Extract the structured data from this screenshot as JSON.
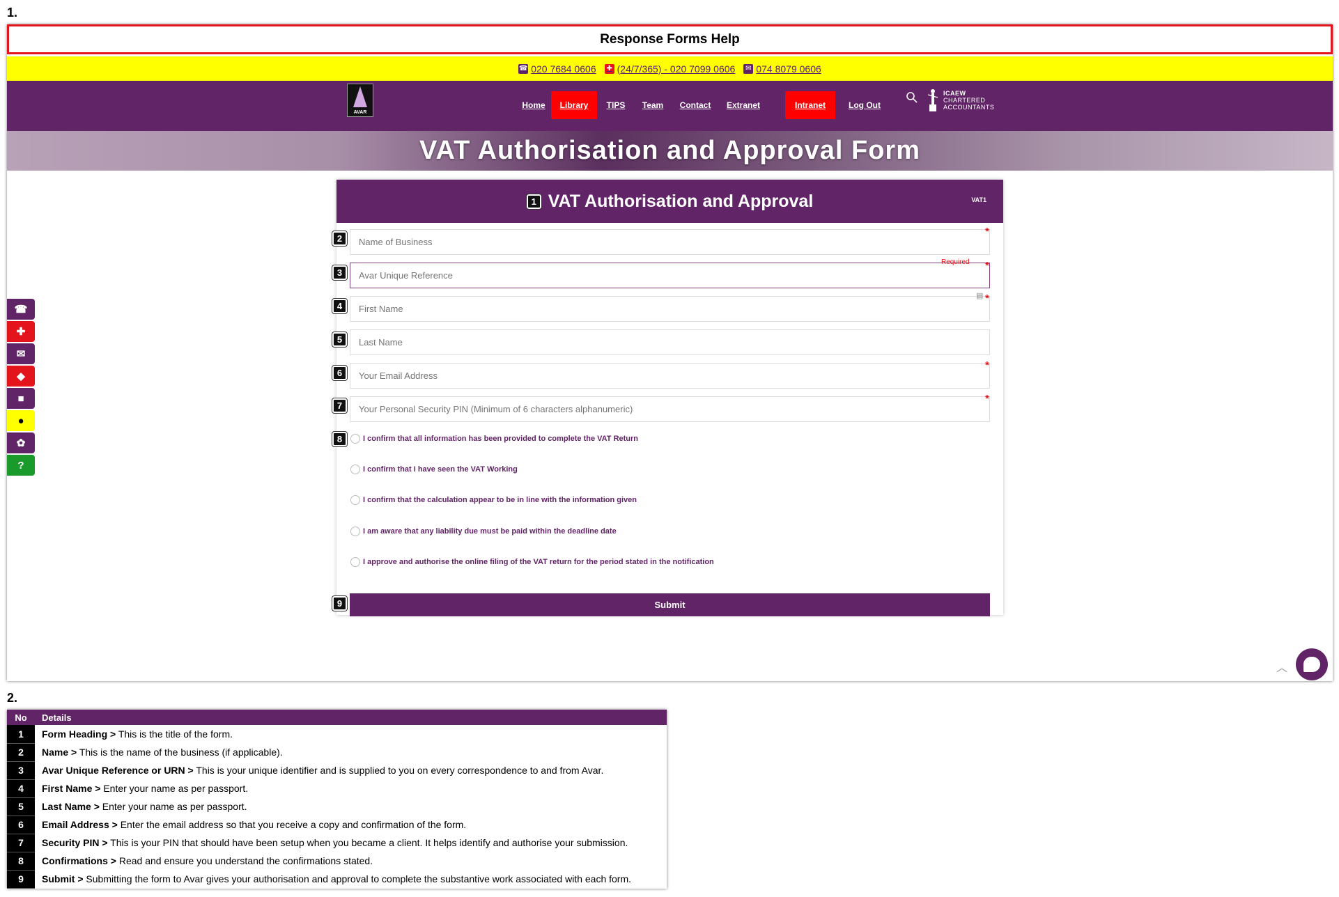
{
  "sections": {
    "first": "1.",
    "second": "2."
  },
  "help_title": "Response Forms Help",
  "phones": [
    {
      "icon": "phone-icon",
      "label": "020 7684 0606",
      "color": "#612466"
    },
    {
      "icon": "ambulance-icon",
      "label": "(24/7/365) - 020 7099 0606",
      "color": "#e3141b"
    },
    {
      "icon": "chat-icon",
      "label": "074 8079 0606",
      "color": "#612466"
    }
  ],
  "logo": {
    "text": "AVAR"
  },
  "nav": [
    {
      "label": "Home",
      "highlight": false
    },
    {
      "label": "Library",
      "highlight": true
    },
    {
      "label": "TIPS",
      "highlight": false
    },
    {
      "label": "Team",
      "highlight": false
    },
    {
      "label": "Contact",
      "highlight": false
    },
    {
      "label": "Extranet",
      "highlight": false
    },
    {
      "label": "Intranet",
      "highlight": true
    },
    {
      "label": "Log Out",
      "highlight": false
    }
  ],
  "icaew": {
    "line1": "ICAEW",
    "line2": "CHARTERED",
    "line3": "ACCOUNTANTS"
  },
  "banner_title": "VAT Authorisation and Approval Form",
  "side_icons": [
    {
      "name": "phone-icon",
      "glyph": "☎",
      "color": "#612466"
    },
    {
      "name": "ambulance-icon",
      "glyph": "🚑",
      "color": "#e3141b"
    },
    {
      "name": "chat-icon",
      "glyph": "💬",
      "color": "#612466"
    },
    {
      "name": "eraser-icon",
      "glyph": "◼",
      "color": "#e3141b"
    },
    {
      "name": "briefcase-icon",
      "glyph": "💼",
      "color": "#612466"
    },
    {
      "name": "lightbulb-icon",
      "glyph": "💡",
      "color": "#ffff00"
    },
    {
      "name": "cookie-icon",
      "glyph": "🍪",
      "color": "#612466"
    },
    {
      "name": "help-icon",
      "glyph": "?",
      "color": "#1a9a2a"
    }
  ],
  "form": {
    "title": "VAT Authorisation and Approval",
    "code": "VAT1",
    "fields": [
      {
        "placeholder": "Name of Business",
        "required": true
      },
      {
        "placeholder": "Avar Unique Reference",
        "required": true,
        "required_text": "Required"
      },
      {
        "placeholder": "First Name",
        "required": true
      },
      {
        "placeholder": "Last Name",
        "required": false
      },
      {
        "placeholder": "Your Email Address",
        "required": true
      },
      {
        "placeholder": "Your Personal Security PIN (Minimum of 6 characters alphanumeric)",
        "required": true
      }
    ],
    "confirmations": [
      "I confirm that all information has been provided to complete the VAT Return",
      "I confirm that I have seen the VAT Working",
      "I confirm that the calculation appear to be in line with the information given",
      "I am aware that any liability due must be paid within the deadline date",
      "I approve and authorise the online filing of the VAT return for the period stated in the notification"
    ],
    "submit_label": "Submit",
    "badges": [
      "1",
      "2",
      "3",
      "4",
      "5",
      "6",
      "7",
      "8",
      "9"
    ]
  },
  "table": {
    "headers": {
      "no": "No",
      "details": "Details"
    },
    "rows": [
      {
        "no": "1",
        "term": "Form Heading >",
        "text": " This is the title of the form."
      },
      {
        "no": "2",
        "term": "Name >",
        "text": " This is the name of the business (if applicable)."
      },
      {
        "no": "3",
        "term": "Avar Unique Reference or URN >",
        "text": " This is your unique identifier and is supplied to you on every correspondence to and from Avar."
      },
      {
        "no": "4",
        "term": "First Name >",
        "text": " Enter your name as per passport."
      },
      {
        "no": "5",
        "term": "Last Name >",
        "text": " Enter your name as per passport."
      },
      {
        "no": "6",
        "term": "Email Address  >",
        "text": " Enter the email address so that you receive a copy and confirmation of the form."
      },
      {
        "no": "7",
        "term": "Security PIN >",
        "text": " This is your PIN that should have been setup when you became a client. It helps identify and authorise your submission."
      },
      {
        "no": "8",
        "term": "Confirmations >",
        "text": " Read and ensure you understand the confirmations stated."
      },
      {
        "no": "9",
        "term": "Submit >",
        "text": " Submitting the form to Avar gives your authorisation and approval to complete the substantive work associated with each form."
      }
    ]
  }
}
